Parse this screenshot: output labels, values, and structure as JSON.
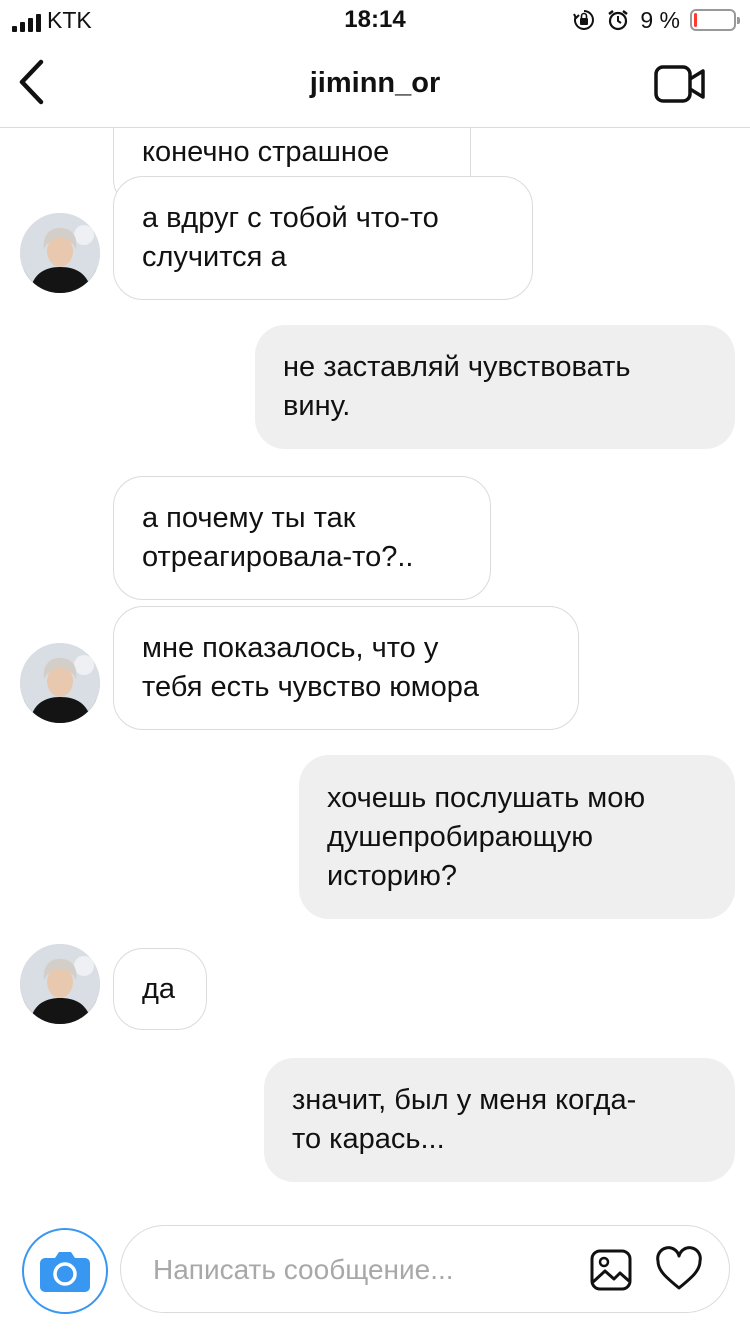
{
  "status_bar": {
    "carrier": "KTK",
    "time": "18:14",
    "battery_percent_label": "9 %",
    "battery_level": 0.09,
    "battery_color": "#ff3b30"
  },
  "header": {
    "title": "jiminn_or",
    "back_icon": "chevron-left-icon",
    "video_icon": "video-camera-icon"
  },
  "messages": [
    {
      "side": "in",
      "lines": [
        "конечно страшное"
      ],
      "avatar": false
    },
    {
      "side": "in",
      "lines": [
        "а вдруг с тобой что-то",
        "случится а"
      ],
      "avatar": true
    },
    {
      "side": "out",
      "lines": [
        "не заставляй чувствовать",
        "вину."
      ]
    },
    {
      "side": "in",
      "lines": [
        "а почему ты так",
        "отреагировала-то?.."
      ],
      "avatar": false
    },
    {
      "side": "in",
      "lines": [
        "мне показалось, что у",
        "тебя есть чувство юмора"
      ],
      "avatar": true
    },
    {
      "side": "out",
      "lines": [
        "хочешь послушать мою",
        "душепробирающую",
        "историю?"
      ]
    },
    {
      "side": "in",
      "lines": [
        "да"
      ],
      "avatar": true
    },
    {
      "side": "out",
      "lines": [
        "значит, был у меня когда-",
        "то карась..."
      ]
    }
  ],
  "composer": {
    "placeholder": "Написать сообщение...",
    "camera_icon": "camera-icon",
    "gallery_icon": "gallery-icon",
    "like_icon": "heart-icon",
    "accent_color": "#3897f0"
  }
}
